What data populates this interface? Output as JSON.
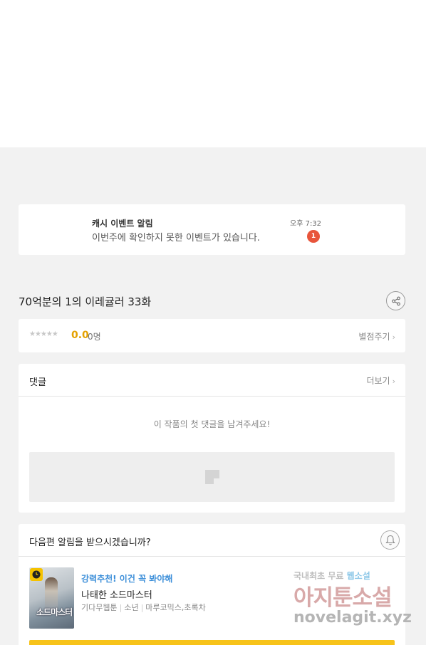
{
  "notification": {
    "title": "캐시 이벤트 알림",
    "message": "이번주에 확인하지 못한 이벤트가 있습니다.",
    "time": "오후 7:32",
    "badge": "1"
  },
  "episode": {
    "title": "70억분의 1의 이레귤러 33화",
    "share_icon": "share-icon"
  },
  "rating": {
    "stars": "★★★★★",
    "score": "0.0",
    "count": "0명",
    "rate_link": "별점주기",
    "chevron": "›"
  },
  "comments": {
    "heading": "댓글",
    "more": "더보기",
    "chevron": "›",
    "empty_message": "이 작품의 첫 댓글을 남겨주세요!"
  },
  "next_alert": {
    "question": "다음편 알림을 받으시겠습니까?",
    "bell_icon": "bell-icon"
  },
  "recommendation": {
    "tag": "강력추천! 이건 꼭 봐야해",
    "name": "나태한 소드마스터",
    "meta": [
      "기다무웹툰",
      "소년",
      "마루코믹스,초록차"
    ],
    "thumb_title": "소드마스터",
    "accent_color": "#3d8fd9"
  },
  "watermark": {
    "line1_a": "국내최초 무료 ",
    "line1_b": "웹소설",
    "line2": "아지툰소설",
    "line3": "novelagit.xyz"
  },
  "colors": {
    "badge": "#e8553b",
    "score": "#e4a100",
    "cta": "#f7c31a"
  }
}
